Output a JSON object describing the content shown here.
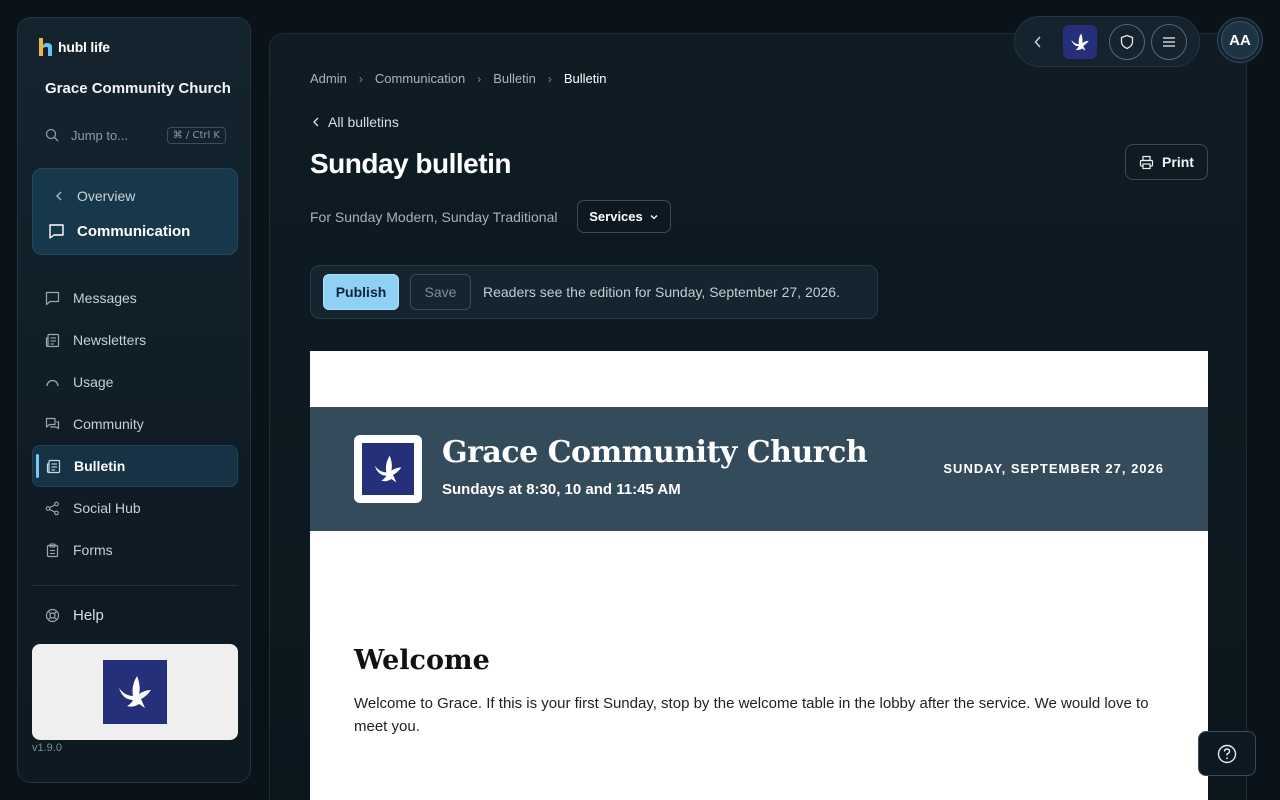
{
  "app": {
    "logo_text": "hubl life",
    "version": "v1.9.0"
  },
  "sidebar": {
    "org_name": "Grace Community Church",
    "jump": {
      "label": "Jump to...",
      "shortcut": "⌘ / Ctrl K"
    },
    "section": {
      "back_label": "Overview",
      "current_label": "Communication"
    },
    "items": [
      {
        "label": "Messages",
        "icon": "message-icon"
      },
      {
        "label": "Newsletters",
        "icon": "newspaper-icon"
      },
      {
        "label": "Usage",
        "icon": "gauge-icon"
      },
      {
        "label": "Community",
        "icon": "chat-bubbles-icon"
      },
      {
        "label": "Bulletin",
        "icon": "newspaper-icon",
        "active": true
      },
      {
        "label": "Social Hub",
        "icon": "share-icon"
      },
      {
        "label": "Forms",
        "icon": "clipboard-icon"
      }
    ],
    "help_label": "Help"
  },
  "breadcrumb": [
    "Admin",
    "Communication",
    "Bulletin",
    "Bulletin"
  ],
  "page": {
    "back_link": "All bulletins",
    "title": "Sunday bulletin",
    "print_label": "Print",
    "subtitle": "For Sunday Modern, Sunday Traditional",
    "services_label": "Services"
  },
  "actions": {
    "publish_label": "Publish",
    "save_label": "Save",
    "note": "Readers see the edition for Sunday, September 27, 2026."
  },
  "bulletin": {
    "church_name": "Grace Community Church",
    "service_times": "Sundays at 8:30, 10 and 11:45 AM",
    "date": "SUNDAY, SEPTEMBER 27, 2026",
    "welcome_heading": "Welcome",
    "welcome_text": "Welcome to Grace. If this is your first Sunday, stop by the welcome table in the lobby after the service. We would love to meet you."
  },
  "user": {
    "initials": "AA"
  },
  "colors": {
    "accent": "#8fd0f5",
    "brand_navy": "#262f7a",
    "banner": "#344b5c"
  }
}
